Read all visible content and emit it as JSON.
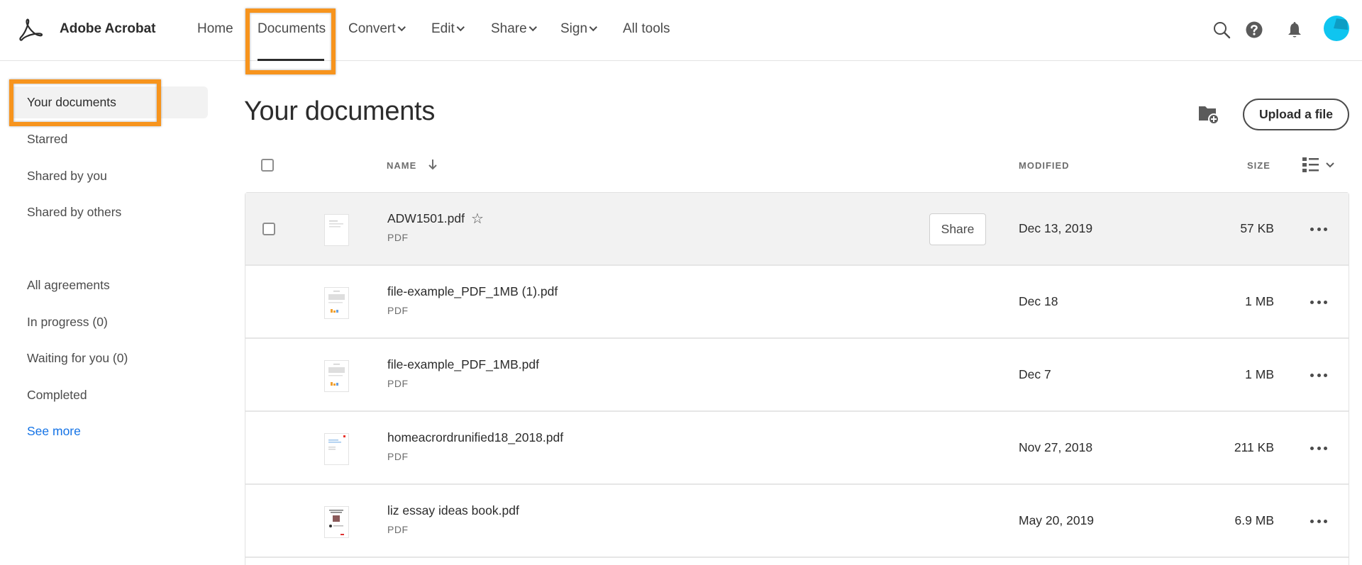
{
  "app": {
    "brand": "Adobe Acrobat",
    "accent_color": "#f7941d",
    "link_color": "#1473e6",
    "avatar_color": "#0fc5f0"
  },
  "nav": {
    "items": [
      {
        "label": "Home",
        "has_dropdown": false,
        "active": false
      },
      {
        "label": "Documents",
        "has_dropdown": false,
        "active": true
      },
      {
        "label": "Convert",
        "has_dropdown": true,
        "active": false
      },
      {
        "label": "Edit",
        "has_dropdown": true,
        "active": false
      },
      {
        "label": "Share",
        "has_dropdown": true,
        "active": false
      },
      {
        "label": "Sign",
        "has_dropdown": true,
        "active": false
      },
      {
        "label": "All tools",
        "has_dropdown": false,
        "active": false
      }
    ],
    "icons": [
      "search-icon",
      "help-icon",
      "bell-icon",
      "avatar"
    ]
  },
  "sidebar": {
    "documents_group": [
      {
        "label": "Your documents",
        "active": true
      },
      {
        "label": "Starred"
      },
      {
        "label": "Shared by you"
      },
      {
        "label": "Shared by others"
      }
    ],
    "agreements_group": [
      {
        "label": "All agreements"
      },
      {
        "label": "In progress (0)"
      },
      {
        "label": "Waiting for you (0)"
      },
      {
        "label": "Completed"
      }
    ],
    "see_more": "See more"
  },
  "main": {
    "title": "Your documents",
    "upload_label": "Upload a file",
    "new_folder_icon": "folder-add-icon",
    "columns": {
      "name": "NAME",
      "modified": "MODIFIED",
      "size": "SIZE"
    },
    "sort": {
      "column": "NAME",
      "direction": "descending"
    },
    "share_label": "Share",
    "files": [
      {
        "name": "ADW1501.pdf",
        "type": "PDF",
        "modified": "Dec 13, 2019",
        "size": "57 KB",
        "hovered": true
      },
      {
        "name": "file-example_PDF_1MB (1).pdf",
        "type": "PDF",
        "modified": "Dec 18",
        "size": "1 MB"
      },
      {
        "name": "file-example_PDF_1MB.pdf",
        "type": "PDF",
        "modified": "Dec 7",
        "size": "1 MB"
      },
      {
        "name": "homeacrordrunified18_2018.pdf",
        "type": "PDF",
        "modified": "Nov 27, 2018",
        "size": "211 KB"
      },
      {
        "name": "liz essay ideas book.pdf",
        "type": "PDF",
        "modified": "May 20, 2019",
        "size": "6.9 MB"
      }
    ]
  }
}
